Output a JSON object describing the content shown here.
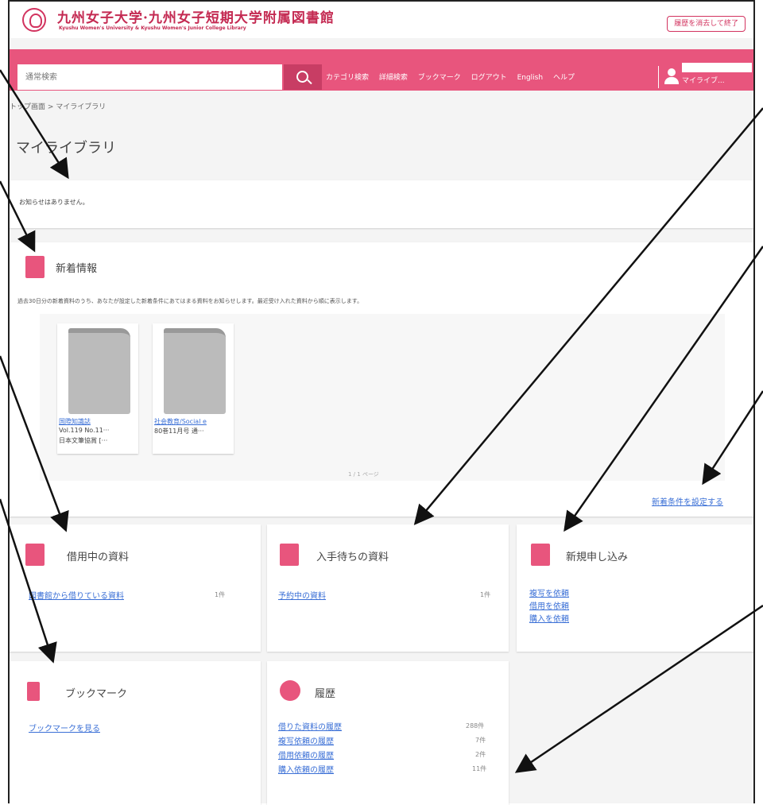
{
  "header": {
    "title": "九州女子大学·九州女子短期大学附属図書館",
    "subtitle": "Kyushu Women's University & Kyushu Women's Junior College Library",
    "exit_button": "履歴を消去して終了"
  },
  "navbar": {
    "search_placeholder": "通常検索",
    "links": [
      "カテゴリ検索",
      "詳細検索",
      "ブックマーク",
      "ログアウト",
      "English",
      "ヘルプ"
    ],
    "user_label": "マイライブ..."
  },
  "breadcrumb": "トップ画面 > マイライブラリ",
  "page_title": "マイライブラリ",
  "notice": "お知らせはありません。",
  "new_arrivals": {
    "title": "新着情報",
    "description": "過去30日分の新着資料のうち、あなたが設定した新着条件にあてはまる資料をお知らせします。最近受け入れた資料から順に表示します。",
    "books": [
      {
        "title": "国際知識誌",
        "line1": "Vol.119 No.11···",
        "line2": "日本文筆協賞 [···"
      },
      {
        "title": "社会教育/Social e",
        "line1": "80巻11月号 通···",
        "line2": ""
      }
    ],
    "pager": "1 / 1 ページ",
    "settings_link": "新着条件を設定する"
  },
  "borrowing": {
    "title": "借用中の資料",
    "link": "図書館から借りている資料",
    "count": "1件"
  },
  "waiting": {
    "title": "入手待ちの資料",
    "link": "予約中の資料",
    "count": "1件"
  },
  "new_request": {
    "title": "新規申し込み",
    "links": [
      "複写を依頼",
      "借用を依頼",
      "購入を依頼"
    ]
  },
  "bookmark": {
    "title": "ブックマーク",
    "link": "ブックマークを見る"
  },
  "history": {
    "title": "履歴",
    "items": [
      {
        "label": "借りた資料の履歴",
        "count": "288件"
      },
      {
        "label": "複写依頼の履歴",
        "count": "7件"
      },
      {
        "label": "借用依頼の履歴",
        "count": "2件"
      },
      {
        "label": "購入依頼の履歴",
        "count": "11件"
      }
    ]
  },
  "colors": {
    "brand": "#e8557d",
    "brand_dark": "#c83d64",
    "link": "#3a6fd6"
  }
}
